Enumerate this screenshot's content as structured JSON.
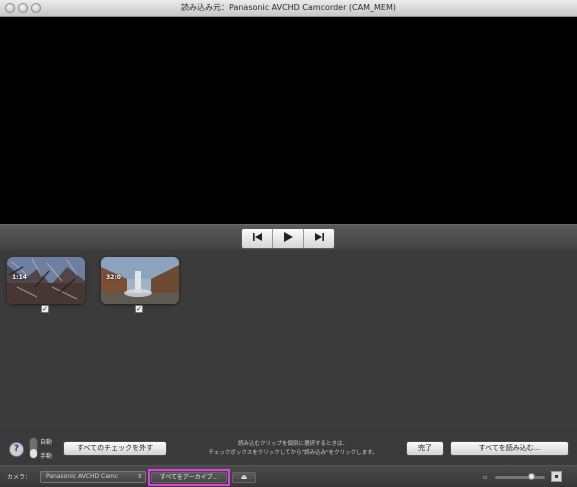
{
  "window": {
    "title": "読み込み元：Panasonic AVCHD Camcorder (CAM_MEM)"
  },
  "transport": {
    "prev_icon": "skip-back-icon",
    "play_icon": "play-icon",
    "next_icon": "skip-forward-icon"
  },
  "clips": [
    {
      "duration": "1:14",
      "checked": true
    },
    {
      "duration": "32:0",
      "checked": true
    }
  ],
  "controls": {
    "help_label": "?",
    "auto_label": "自動",
    "manual_label": "手動",
    "uncheck_all": "すべてのチェックを外す",
    "instructions_line1": "読み込むクリップを個別に選択するときは、",
    "instructions_line2": "チェックボックスをクリックしてから\"読み込み\"をクリックします。",
    "done": "完了",
    "import_all": "すべてを読み込む..."
  },
  "statusbar": {
    "camera_label": "カメラ：",
    "camera_value": "Panasonic AVCHD Camc",
    "archive_all": "すべてをアーカイブ...",
    "eject_icon": "eject-icon",
    "zoom_level": 0.72
  },
  "colors": {
    "highlight": "#e23ee5",
    "video_bg": "#000000",
    "panel_bg": "#3b3b3b"
  }
}
